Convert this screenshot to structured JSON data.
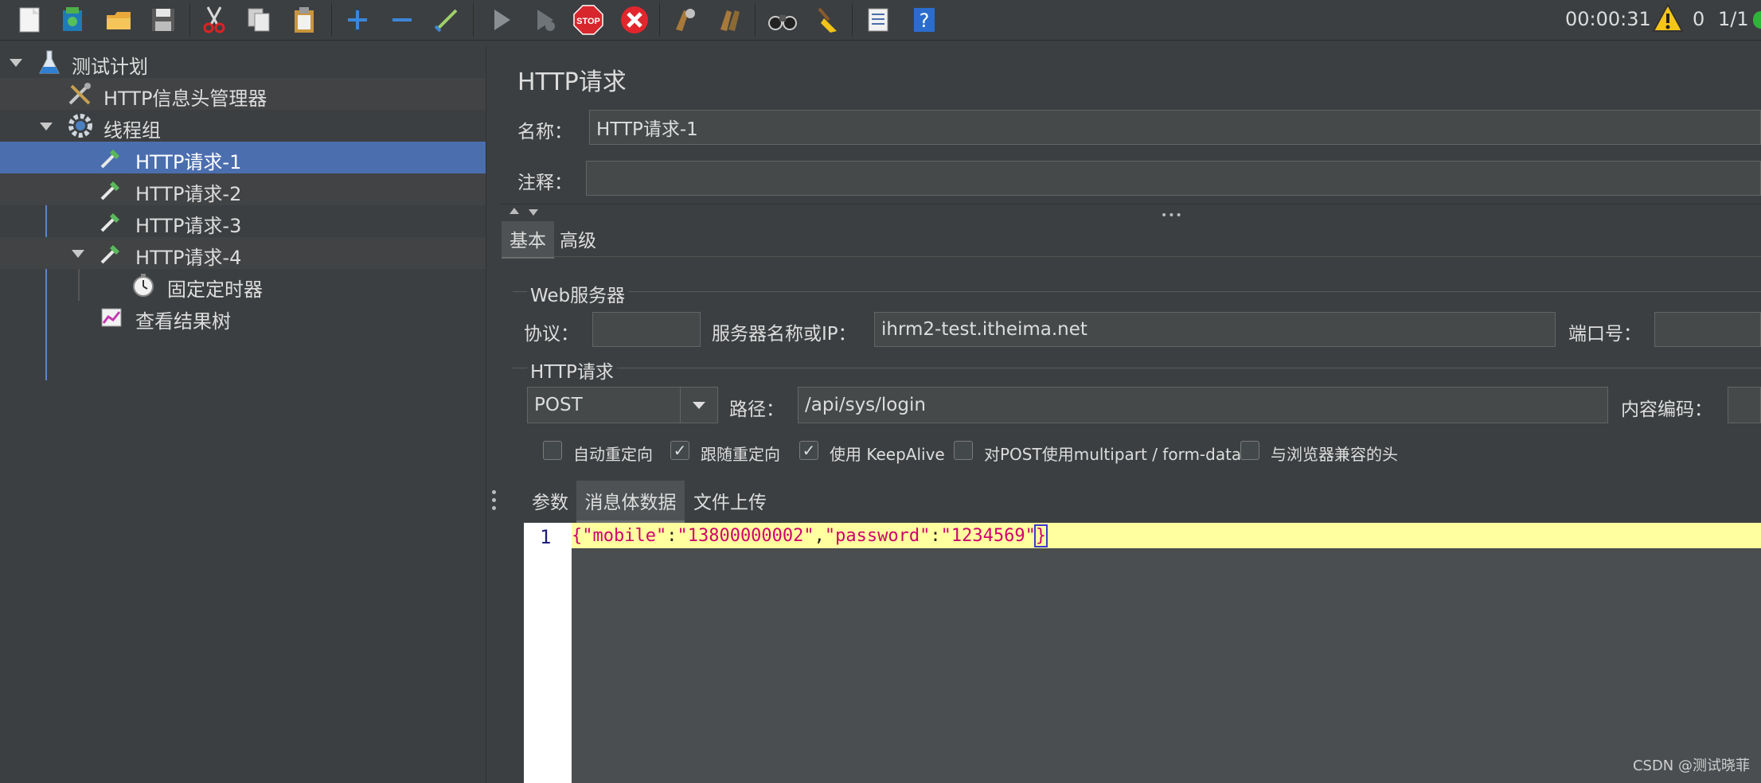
{
  "toolbar": {
    "icons": [
      "new-icon",
      "templates-icon",
      "open-icon",
      "save-icon",
      "cut-icon",
      "copy-icon",
      "paste-icon",
      "expand-icon",
      "collapse-icon",
      "toggle-icon",
      "start-icon",
      "start-no-pause-icon",
      "stop-icon",
      "shutdown-icon",
      "clear-icon",
      "clear-all-icon",
      "search-icon",
      "reset-search-icon",
      "function-helper-icon",
      "help-icon"
    ],
    "timer": "00:00:31",
    "warning_count": "0",
    "threads": "1/1"
  },
  "tree": {
    "items": [
      {
        "label": "测试计划"
      },
      {
        "label": "HTTP信息头管理器"
      },
      {
        "label": "线程组"
      },
      {
        "label": "HTTP请求-1"
      },
      {
        "label": "HTTP请求-2"
      },
      {
        "label": "HTTP请求-3"
      },
      {
        "label": "HTTP请求-4"
      },
      {
        "label": "固定定时器"
      },
      {
        "label": "查看结果树"
      }
    ]
  },
  "panel": {
    "title": "HTTP请求",
    "name_label": "名称：",
    "name_value": "HTTP请求-1",
    "comment_label": "注释：",
    "comment_value": "",
    "tabs": [
      "基本",
      "高级"
    ],
    "web_server_title": "Web服务器",
    "protocol_label": "协议：",
    "protocol_value": "",
    "server_label": "服务器名称或IP：",
    "server_value": "ihrm2-test.itheima.net",
    "port_label": "端口号：",
    "port_value": "",
    "http_request_title": "HTTP请求",
    "method_value": "POST",
    "path_label": "路径：",
    "path_value": "/api/sys/login",
    "encoding_label": "内容编码：",
    "checkboxes": [
      {
        "label": "自动重定向",
        "checked": false
      },
      {
        "label": "跟随重定向",
        "checked": true
      },
      {
        "label": "使用 KeepAlive",
        "checked": true
      },
      {
        "label": "对POST使用multipart / form-data",
        "checked": false
      },
      {
        "label": "与浏览器兼容的头",
        "checked": false
      }
    ],
    "body_tabs": [
      "参数",
      "消息体数据",
      "文件上传"
    ],
    "code_line_number": "1",
    "code": {
      "open": "{",
      "k1": "\"mobile\"",
      "colon": ":",
      "v1": "\"13800000002\"",
      "comma": ",",
      "k2": "\"password\"",
      "v2": "\"1234569\"",
      "close": "}"
    }
  },
  "watermark": "CSDN @测试晓菲"
}
